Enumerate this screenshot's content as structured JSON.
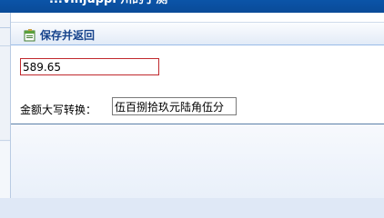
{
  "window": {
    "title": "...vinjuppl 州的子测"
  },
  "toolbar": {
    "save_label": "保存并返回",
    "save_icon": "save-back-icon"
  },
  "form": {
    "amount_value": "589.65",
    "convert_label": "金额大写转换：",
    "convert_value": "伍百捌拾玖元陆角伍分"
  },
  "colors": {
    "title_bar": "#0b54a8",
    "toolbar_text": "#15428b",
    "input_border_error": "#c0282d"
  }
}
